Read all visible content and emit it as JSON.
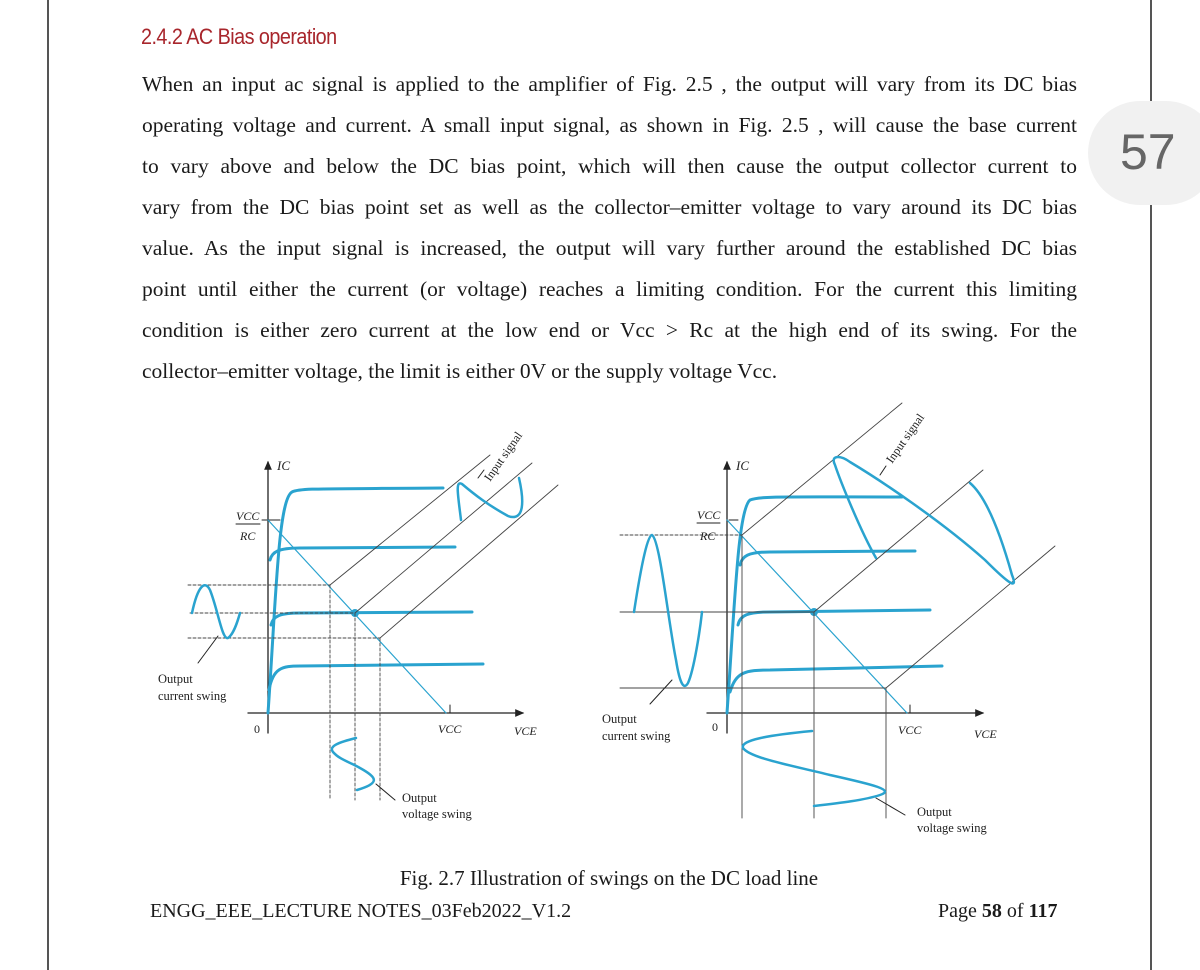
{
  "page_badge": "57",
  "section_heading": "2.4.2 AC Bias operation",
  "paragraph_lines": [
    "When an input ac signal is applied to the amplifier of Fig. 2.5 , the output will vary from its DC bias",
    "operating voltage and current. A small input signal, as shown in Fig. 2.5 , will cause the base current",
    "to vary above and below the DC bias point, which will then cause the output collector current to",
    "vary from the DC bias point set as well as the collector–emitter voltage to vary around its DC bias",
    "value. As the input signal is increased, the output will vary further around the established DC bias",
    "point until either the current (or voltage) reaches a limiting condition. For the current this limiting",
    "condition is either zero current at the low end or Vcc > Rc at the high end of its swing. For the",
    "collector–emitter voltage, the limit is either 0V or the supply voltage Vcc."
  ],
  "figure": {
    "labels": {
      "ic": "IC",
      "vcc_num": "VCC",
      "rc_den": "RC",
      "origin": "0",
      "vcc_axis": "VCC",
      "vce": "VCE",
      "input_signal": "Input signal",
      "output_current_1": "Output",
      "output_current_2": "current swing",
      "output_voltage_1": "Output",
      "output_voltage_2": "voltage swing"
    },
    "curve_color": "#2aa3cf",
    "caption": "Fig. 2.7 Illustration of swings on the DC load line"
  },
  "footer": {
    "doc_name": "ENGG_EEE_LECTURE NOTES_03Feb2022_V1.2",
    "page_prefix": "Page ",
    "page_current": "58",
    "page_of": " of ",
    "page_total": "117"
  }
}
